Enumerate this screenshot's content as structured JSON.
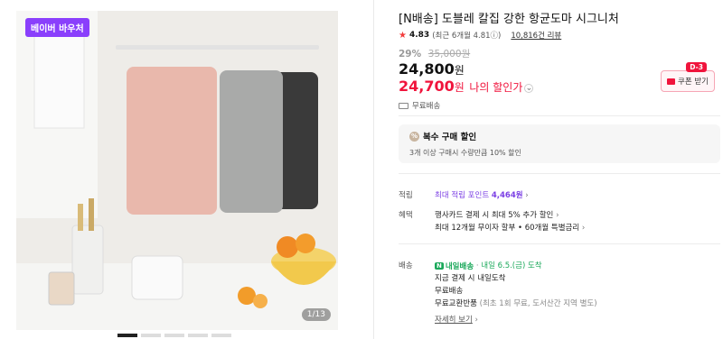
{
  "gallery": {
    "badge": "베이버 바우처",
    "counter": "1/13"
  },
  "product": {
    "title": "[N배송] 도블레 칼집 강한 항균도마 시그니처",
    "rating": {
      "star": "★",
      "score": "4.83",
      "recent": "(최근 6개월 4.81ⓘ)",
      "reviews": "10,816건 리뷰"
    },
    "discount_rate": "29%",
    "original_price": "35,000원",
    "price": "24,800",
    "won": "원",
    "my_price": "24,700",
    "my_price_label": "나의 할인가",
    "coupon": {
      "label": "쿠폰 받기",
      "tag": "D-3"
    },
    "free_shipping": "무료배송"
  },
  "bulk": {
    "title": "복수 구매 할인",
    "desc": "3개 이상 구매시 수량만큼 10% 할인"
  },
  "points": {
    "label": "적립",
    "text": "최대 적립 포인트",
    "value": "4,464원"
  },
  "benefits": {
    "label": "혜택",
    "line1": "행사카드 결제 시 최대 5% 추가 할인",
    "line2": "최대 12개월 무이자 할부 • 60개월 특별금리"
  },
  "delivery": {
    "label": "배송",
    "badge": "내일배송",
    "date": "내일 6.5.(금) 도착",
    "line1": "지금 결제 시 내일도착",
    "line2": "무료배송",
    "line3": "무료교환반품",
    "line3_note": "(최초 1회 무료, 도서산간 지역 별도)",
    "more": "자세히 보기"
  }
}
